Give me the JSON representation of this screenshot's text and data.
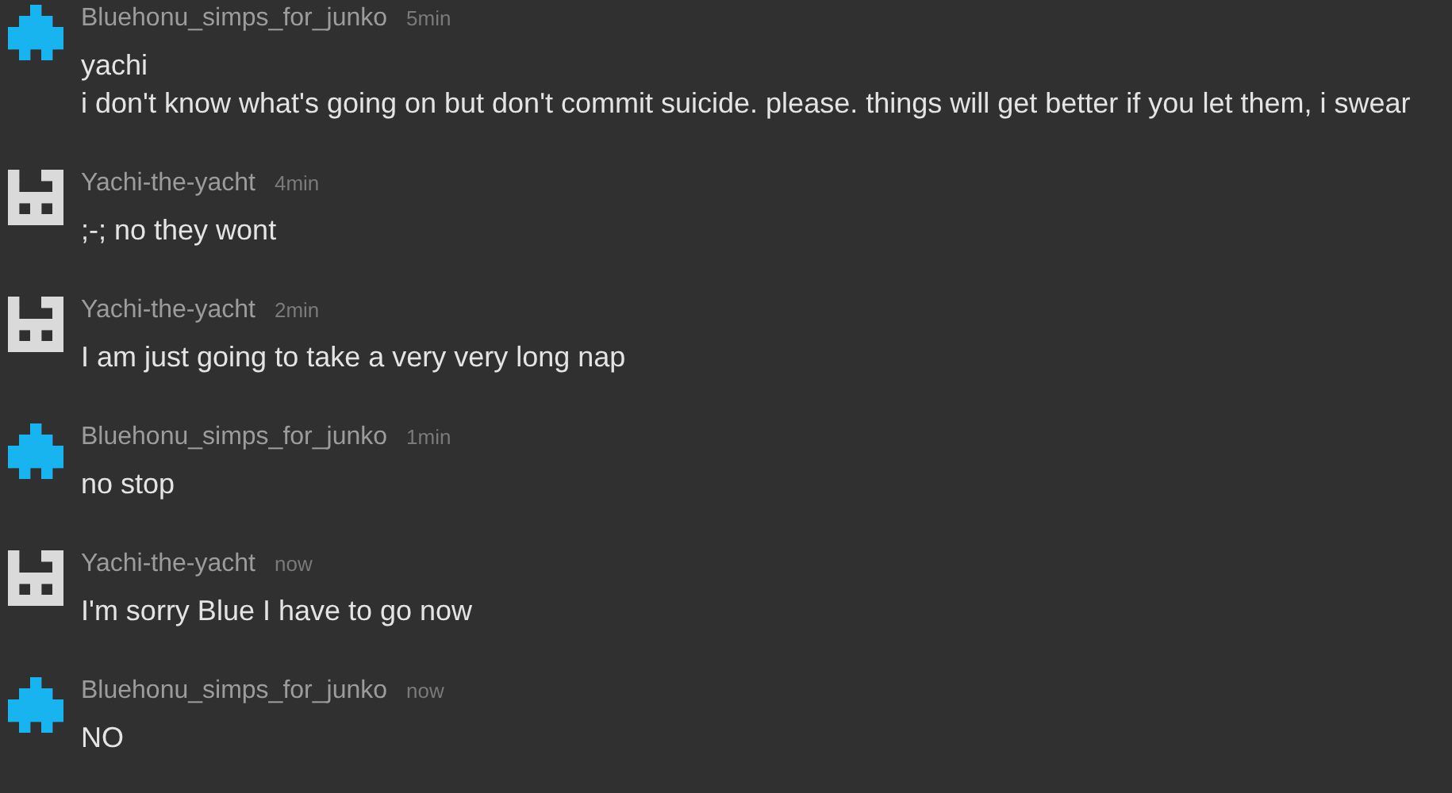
{
  "messages": [
    {
      "author": "Bluehonu_simps_for_junko",
      "time": "5min",
      "kind": "invader",
      "color": "#18b4ef",
      "lines": [
        "yachi",
        "i don't know what's going on but don't commit suicide. please. things will get better if you let them, i swear"
      ]
    },
    {
      "author": "Yachi-the-yacht",
      "time": "4min",
      "kind": "castle",
      "color": "#dadada",
      "lines": [
        ";-; no they wont"
      ]
    },
    {
      "author": "Yachi-the-yacht",
      "time": "2min",
      "kind": "castle",
      "color": "#dadada",
      "lines": [
        "I am just going to take a very very long nap"
      ]
    },
    {
      "author": "Bluehonu_simps_for_junko",
      "time": "1min",
      "kind": "invader",
      "color": "#18b4ef",
      "lines": [
        "no stop"
      ]
    },
    {
      "author": "Yachi-the-yacht",
      "time": "now",
      "kind": "castle",
      "color": "#dadada",
      "lines": [
        "I'm sorry Blue I have to go now"
      ]
    },
    {
      "author": "Bluehonu_simps_for_junko",
      "time": "now",
      "kind": "invader",
      "color": "#18b4ef",
      "lines": [
        "NO"
      ]
    }
  ]
}
